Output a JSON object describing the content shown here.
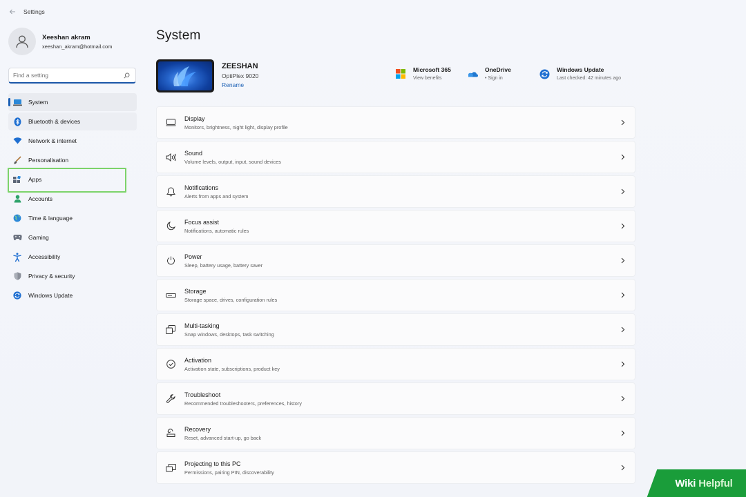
{
  "window": {
    "title": "Settings"
  },
  "profile": {
    "name": "Xeeshan akram",
    "email": "xeeshan_akram@hotmail.com"
  },
  "search": {
    "placeholder": "Find a setting"
  },
  "sidebar": {
    "items": [
      {
        "label": "System",
        "icon": "laptop-icon"
      },
      {
        "label": "Bluetooth & devices",
        "icon": "bluetooth-icon"
      },
      {
        "label": "Network & internet",
        "icon": "wifi-icon"
      },
      {
        "label": "Personalisation",
        "icon": "brush-icon"
      },
      {
        "label": "Apps",
        "icon": "apps-icon"
      },
      {
        "label": "Accounts",
        "icon": "person-icon"
      },
      {
        "label": "Time & language",
        "icon": "globe-icon"
      },
      {
        "label": "Gaming",
        "icon": "gamepad-icon"
      },
      {
        "label": "Accessibility",
        "icon": "accessibility-icon"
      },
      {
        "label": "Privacy & security",
        "icon": "shield-icon"
      },
      {
        "label": "Windows Update",
        "icon": "update-icon"
      }
    ],
    "active": "System",
    "highlighted": "Apps"
  },
  "main": {
    "title": "System",
    "device": {
      "name": "ZEESHAN",
      "model": "OptiPlex 9020",
      "rename_label": "Rename"
    },
    "quick_links": [
      {
        "title": "Microsoft 365",
        "subtitle": "View benefits",
        "icon": "microsoft-logo-icon"
      },
      {
        "title": "OneDrive",
        "subtitle": "• Sign in",
        "icon": "cloud-icon"
      },
      {
        "title": "Windows Update",
        "subtitle": "Last checked: 42 minutes ago",
        "icon": "update-icon"
      }
    ],
    "cards": [
      {
        "title": "Display",
        "subtitle": "Monitors, brightness, night light, display profile",
        "icon": "monitor-icon"
      },
      {
        "title": "Sound",
        "subtitle": "Volume levels, output, input, sound devices",
        "icon": "speaker-icon"
      },
      {
        "title": "Notifications",
        "subtitle": "Alerts from apps and system",
        "icon": "bell-icon"
      },
      {
        "title": "Focus assist",
        "subtitle": "Notifications, automatic rules",
        "icon": "moon-icon"
      },
      {
        "title": "Power",
        "subtitle": "Sleep, battery usage, battery saver",
        "icon": "power-icon"
      },
      {
        "title": "Storage",
        "subtitle": "Storage space, drives, configuration rules",
        "icon": "storage-icon"
      },
      {
        "title": "Multi-tasking",
        "subtitle": "Snap windows, desktops, task switching",
        "icon": "multitask-icon"
      },
      {
        "title": "Activation",
        "subtitle": "Activation state, subscriptions, product key",
        "icon": "check-circle-icon"
      },
      {
        "title": "Troubleshoot",
        "subtitle": "Recommended troubleshooters, preferences, history",
        "icon": "wrench-icon"
      },
      {
        "title": "Recovery",
        "subtitle": "Reset, advanced start-up, go back",
        "icon": "recovery-icon"
      },
      {
        "title": "Projecting to this PC",
        "subtitle": "Permissions, pairing PIN, discoverability",
        "icon": "projector-icon"
      }
    ]
  },
  "watermark": {
    "part1": "Wiki",
    "part2": "Helpful"
  },
  "colors": {
    "accent": "#1a5fb4",
    "highlight": "#7cd36a",
    "watermark": "#1a9d3a"
  }
}
